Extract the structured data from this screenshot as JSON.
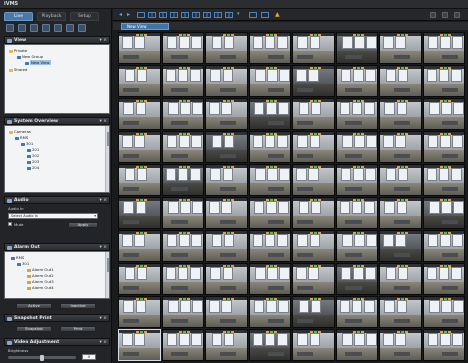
{
  "window": {
    "title": "iVMS"
  },
  "left_tabs": [
    {
      "label": "Live",
      "active": true
    },
    {
      "label": "Playback",
      "active": false
    },
    {
      "label": "Setup",
      "active": false
    }
  ],
  "panels": {
    "view": {
      "title": "View",
      "tree": [
        {
          "label": "Private",
          "icon": "folder-icon",
          "level": 0
        },
        {
          "label": "New Group",
          "icon": "camera-icon",
          "level": 1
        },
        {
          "label": "New View",
          "icon": "view-icon",
          "level": 2,
          "selected": true
        },
        {
          "label": "Shared",
          "icon": "folder-icon",
          "level": 0
        }
      ]
    },
    "system_overview": {
      "title": "System Overview",
      "tree": [
        {
          "label": "Cameras",
          "icon": "folder-icon",
          "level": 0
        },
        {
          "label": "RMS",
          "icon": "server-icon",
          "level": 1
        },
        {
          "label": "301",
          "icon": "camera-icon",
          "level": 2
        },
        {
          "label": "201",
          "icon": "camera-icon",
          "level": 3
        },
        {
          "label": "202",
          "icon": "camera-icon",
          "level": 3
        },
        {
          "label": "203",
          "icon": "camera-icon",
          "level": 3
        },
        {
          "label": "204",
          "icon": "camera-icon",
          "level": 3
        }
      ]
    },
    "audio": {
      "title": "Audio",
      "audio_in_label": "Audio In",
      "select_value": "Select Audio In",
      "mute_label": "Mute",
      "apply_label": "Apply"
    },
    "alarm_out": {
      "title": "Alarm Out",
      "tree": [
        {
          "label": "RMS",
          "icon": "server-icon",
          "level": 0
        },
        {
          "label": "301",
          "icon": "camera-icon",
          "level": 1
        },
        {
          "label": "Alarm Out1",
          "icon": "alarm-icon",
          "level": 2
        },
        {
          "label": "Alarm Out2",
          "icon": "alarm-icon",
          "level": 2
        },
        {
          "label": "Alarm Out3",
          "icon": "alarm-icon",
          "level": 2
        },
        {
          "label": "Alarm Out4",
          "icon": "alarm-icon",
          "level": 2
        }
      ],
      "activate_label": "Active",
      "deactivate_label": "Inactive"
    },
    "snapshot": {
      "title": "Snapshot Print",
      "snapshot_label": "Snapshot",
      "print_label": "Print"
    },
    "video_adjustment": {
      "title": "Video Adjustment",
      "brightness_label": "Brightness",
      "brightness_value": "0"
    }
  },
  "view_tab": {
    "label": "New View"
  },
  "grid": {
    "rows": 10,
    "cols": 8,
    "highlight_index": 72
  }
}
